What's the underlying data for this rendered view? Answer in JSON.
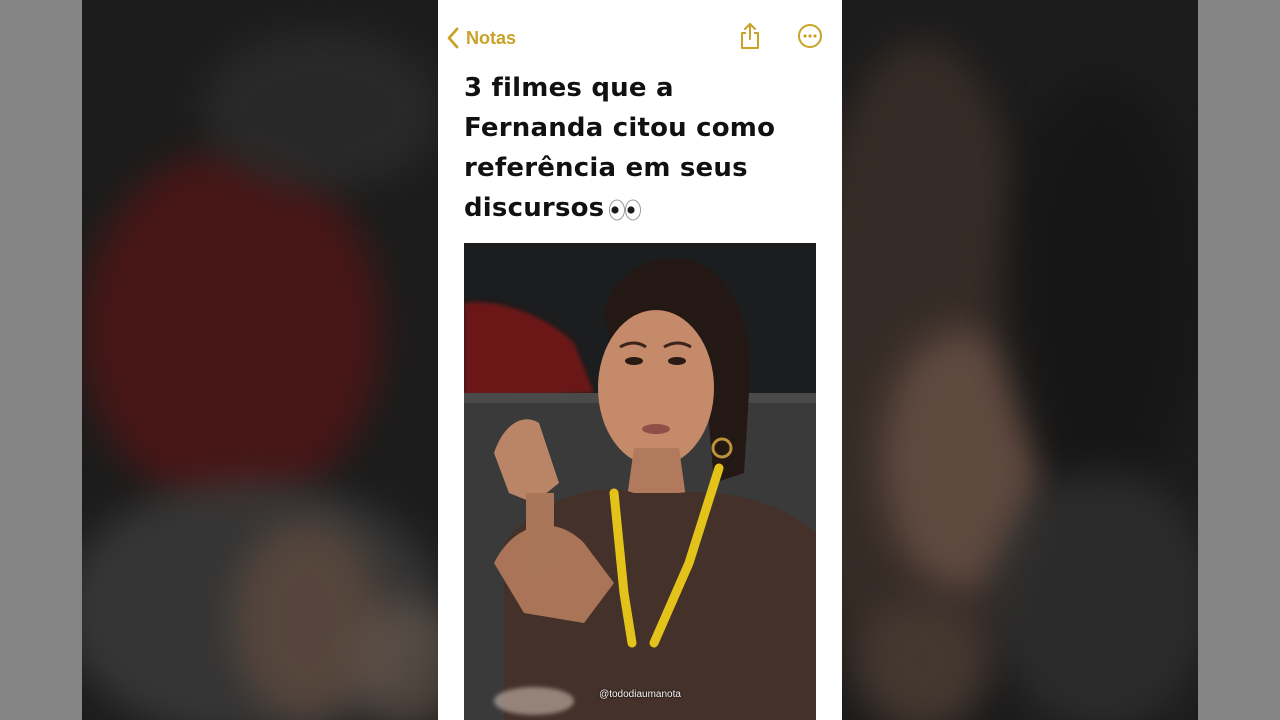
{
  "nav": {
    "back_label": "Notas",
    "back_icon": "chevron-left-icon",
    "share_icon": "share-icon",
    "more_icon": "ellipsis-circle-icon",
    "accent_color": "#c9a227"
  },
  "note": {
    "title_line1": "3 filmes que a",
    "title_line2": "Fernanda citou como",
    "title_line3": "referência em seus",
    "title_line4": "discursos",
    "title_emoji": "eyes-emoji"
  },
  "photo": {
    "watermark": "@tododiaumanota"
  }
}
